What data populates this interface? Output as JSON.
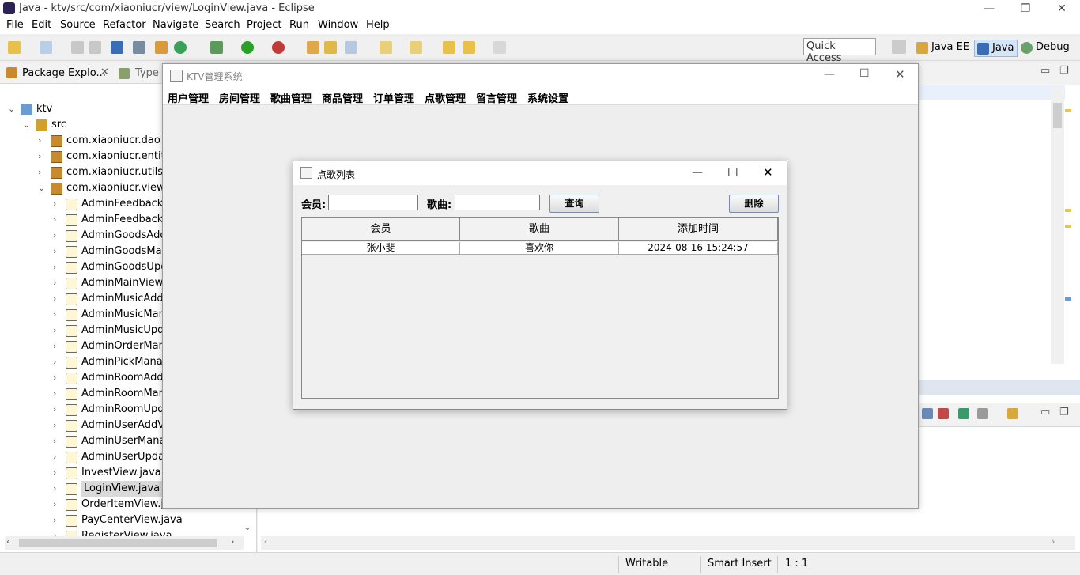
{
  "eclipse": {
    "title": "Java - ktv/src/com/xiaoniucr/view/LoginView.java - Eclipse",
    "menu": [
      "File",
      "Edit",
      "Source",
      "Refactor",
      "Navigate",
      "Search",
      "Project",
      "Run",
      "Window",
      "Help"
    ],
    "quick_access": "Quick Access",
    "perspectives": [
      "Java EE",
      "Java",
      "Debug"
    ]
  },
  "package_explorer": {
    "tab_label": "Package Explo...",
    "tab2_label": "Type",
    "tree": [
      {
        "label": "ktv",
        "icon": "project-icon",
        "level": 0,
        "expanded": true
      },
      {
        "label": "src",
        "icon": "source-folder-icon",
        "level": 1,
        "expanded": true
      },
      {
        "label": "com.xiaoniucr.dao",
        "icon": "package-icon",
        "level": 2,
        "expanded": false
      },
      {
        "label": "com.xiaoniucr.entity",
        "icon": "package-icon",
        "level": 2,
        "expanded": false
      },
      {
        "label": "com.xiaoniucr.utils",
        "icon": "package-icon",
        "level": 2,
        "expanded": false
      },
      {
        "label": "com.xiaoniucr.view",
        "icon": "package-icon",
        "level": 2,
        "expanded": true
      },
      {
        "label": "AdminFeedbackM",
        "icon": "java-file-icon",
        "level": 3
      },
      {
        "label": "AdminFeedbackR",
        "icon": "java-file-icon",
        "level": 3
      },
      {
        "label": "AdminGoodsAdd",
        "icon": "java-file-icon",
        "level": 3
      },
      {
        "label": "AdminGoodsMar",
        "icon": "java-file-icon",
        "level": 3
      },
      {
        "label": "AdminGoodsUpd",
        "icon": "java-file-icon",
        "level": 3
      },
      {
        "label": "AdminMainView.j",
        "icon": "java-file-icon",
        "level": 3
      },
      {
        "label": "AdminMusicAddV",
        "icon": "java-file-icon",
        "level": 3
      },
      {
        "label": "AdminMusicMana",
        "icon": "java-file-icon",
        "level": 3
      },
      {
        "label": "AdminMusicUpda",
        "icon": "java-file-icon",
        "level": 3
      },
      {
        "label": "AdminOrderMana",
        "icon": "java-file-icon",
        "level": 3
      },
      {
        "label": "AdminPickManag",
        "icon": "java-file-icon",
        "level": 3
      },
      {
        "label": "AdminRoomAddV",
        "icon": "java-file-icon",
        "level": 3
      },
      {
        "label": "AdminRoomMana",
        "icon": "java-file-icon",
        "level": 3
      },
      {
        "label": "AdminRoomUpda",
        "icon": "java-file-icon",
        "level": 3
      },
      {
        "label": "AdminUserAddVi",
        "icon": "java-file-icon",
        "level": 3
      },
      {
        "label": "AdminUserManag",
        "icon": "java-file-icon",
        "level": 3
      },
      {
        "label": "AdminUserUpdat",
        "icon": "java-file-icon",
        "level": 3
      },
      {
        "label": "InvestView.java",
        "icon": "java-file-icon",
        "level": 3
      },
      {
        "label": "LoginView.java",
        "icon": "java-file-icon",
        "level": 3,
        "selected": true
      },
      {
        "label": "OrderItemView.java",
        "icon": "java-file-icon",
        "level": 3
      },
      {
        "label": "PayCenterView.java",
        "icon": "java-file-icon",
        "level": 3
      },
      {
        "label": "RegisterView.java",
        "icon": "java-file-icon",
        "level": 3
      }
    ]
  },
  "status_bar": {
    "writable": "Writable",
    "insert_mode": "Smart Insert",
    "position": "1 : 1"
  },
  "ktv_window": {
    "title": "KTV管理系统",
    "menu": [
      "用户管理",
      "房间管理",
      "歌曲管理",
      "商品管理",
      "订单管理",
      "点歌管理",
      "留言管理",
      "系统设置"
    ]
  },
  "dialog": {
    "title": "点歌列表",
    "member_label": "会员:",
    "song_label": "歌曲:",
    "member_value": "",
    "song_value": "",
    "query_button": "查询",
    "delete_button": "删除",
    "columns": [
      "会员",
      "歌曲",
      "添加时间"
    ],
    "rows": [
      [
        "张小斐",
        "喜欢你",
        "2024-08-16 15:24:57"
      ]
    ]
  }
}
